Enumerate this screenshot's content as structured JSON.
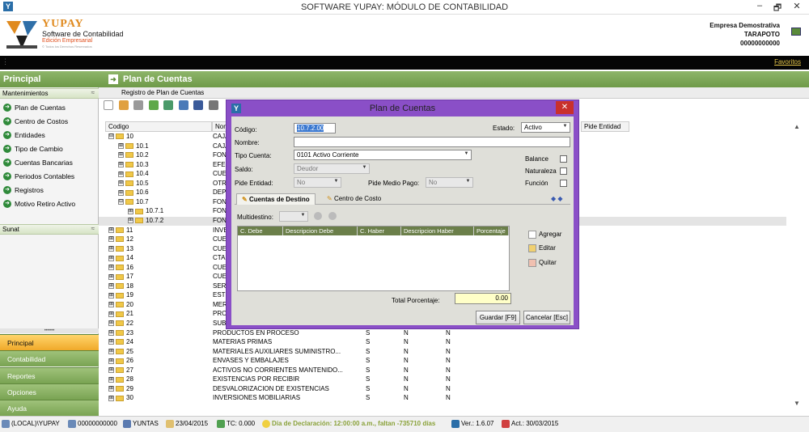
{
  "window": {
    "title": "SOFTWARE YUPAY: MÓDULO DE CONTABILIDAD",
    "minimize": "–",
    "restore": "🗗",
    "close": "✕"
  },
  "brand": {
    "name": "YUPAY",
    "subtitle": "Software de Contabilidad",
    "edition": "Edición Empresarial",
    "copyright": "© Todos los Derechos Reservados"
  },
  "company": {
    "name": "Empresa Demostrativa",
    "city": "TARAPOTO",
    "ruc": "00000000000"
  },
  "favorites_link": "Favoritos",
  "sidebar": {
    "title": "Principal",
    "section1": "Mantenimientos",
    "items": [
      {
        "label": "Plan de Cuentas"
      },
      {
        "label": "Centro de Costos"
      },
      {
        "label": "Entidades"
      },
      {
        "label": "Tipo de Cambio"
      },
      {
        "label": "Cuentas Bancarias"
      },
      {
        "label": "Periodos Contables"
      },
      {
        "label": "Registros"
      },
      {
        "label": "Motivo Retiro Activo"
      }
    ],
    "section2": "Sunat",
    "grip": "••••••",
    "modules": [
      "Principal",
      "Contabilidad",
      "Reportes",
      "Opciones",
      "Ayuda"
    ]
  },
  "main": {
    "title": "Plan de Cuentas",
    "tab": "Registro de Plan de Cuentas",
    "columns": {
      "codigo": "Codigo",
      "nombre": "Nombre",
      "pide_entidad": "Pide Entidad"
    },
    "tree": [
      {
        "code": "10",
        "level": 0,
        "sign": "⊟",
        "name": "CAJA Y BANCOS",
        "c1": "",
        "c2": "",
        "c3": ""
      },
      {
        "code": "10.1",
        "level": 1,
        "sign": "⊞",
        "name": "CAJA",
        "c1": "",
        "c2": "",
        "c3": ""
      },
      {
        "code": "10.2",
        "level": 1,
        "sign": "⊞",
        "name": "FONDOS FIJOS",
        "c1": "",
        "c2": "",
        "c3": ""
      },
      {
        "code": "10.3",
        "level": 1,
        "sign": "⊞",
        "name": "EFECTIVO EN TRANSITO",
        "c1": "",
        "c2": "",
        "c3": ""
      },
      {
        "code": "10.4",
        "level": 1,
        "sign": "⊞",
        "name": "CUENTAS CORRIENTES",
        "c1": "",
        "c2": "",
        "c3": ""
      },
      {
        "code": "10.5",
        "level": 1,
        "sign": "⊞",
        "name": "OTROS EQUIVALENTES",
        "c1": "",
        "c2": "",
        "c3": ""
      },
      {
        "code": "10.6",
        "level": 1,
        "sign": "⊞",
        "name": "DEPOSITOS A PLAZO",
        "c1": "",
        "c2": "",
        "c3": ""
      },
      {
        "code": "10.7",
        "level": 1,
        "sign": "⊟",
        "name": "FONDOS SUJETOS A RESTRICCION",
        "c1": "",
        "c2": "",
        "c3": ""
      },
      {
        "code": "10.7.1",
        "level": 2,
        "sign": "⊞",
        "name": "FONDOS",
        "c1": "",
        "c2": "",
        "c3": ""
      },
      {
        "code": "10.7.2",
        "level": 2,
        "sign": "⊞",
        "name": "FONDOS",
        "c1": "",
        "c2": "",
        "c3": "",
        "selected": true
      },
      {
        "code": "11",
        "level": 0,
        "sign": "⊞",
        "name": "INVERSIONES",
        "c1": "",
        "c2": "",
        "c3": ""
      },
      {
        "code": "12",
        "level": 0,
        "sign": "⊞",
        "name": "CUENTAS POR COBRAR",
        "c1": "",
        "c2": "",
        "c3": ""
      },
      {
        "code": "13",
        "level": 0,
        "sign": "⊞",
        "name": "CUENTAS",
        "c1": "",
        "c2": "",
        "c3": ""
      },
      {
        "code": "14",
        "level": 0,
        "sign": "⊞",
        "name": "CTAS",
        "c1": "",
        "c2": "",
        "c3": ""
      },
      {
        "code": "16",
        "level": 0,
        "sign": "⊞",
        "name": "CUENTAS",
        "c1": "",
        "c2": "",
        "c3": ""
      },
      {
        "code": "17",
        "level": 0,
        "sign": "⊞",
        "name": "CUENTAS",
        "c1": "",
        "c2": "",
        "c3": ""
      },
      {
        "code": "18",
        "level": 0,
        "sign": "⊞",
        "name": "SERVICIOS",
        "c1": "",
        "c2": "",
        "c3": ""
      },
      {
        "code": "19",
        "level": 0,
        "sign": "⊞",
        "name": "ESTIMACION",
        "c1": "",
        "c2": "",
        "c3": ""
      },
      {
        "code": "20",
        "level": 0,
        "sign": "⊞",
        "name": "MERCADERIAS",
        "c1": "",
        "c2": "",
        "c3": ""
      },
      {
        "code": "21",
        "level": 0,
        "sign": "⊞",
        "name": "PRODUCTOS",
        "c1": "",
        "c2": "",
        "c3": ""
      },
      {
        "code": "22",
        "level": 0,
        "sign": "⊞",
        "name": "SUBPRODUCTOS",
        "c1": "",
        "c2": "",
        "c3": ""
      },
      {
        "code": "23",
        "level": 0,
        "sign": "⊞",
        "name": "PRODUCTOS EN PROCESO",
        "c1": "S",
        "c2": "N",
        "c3": "N"
      },
      {
        "code": "24",
        "level": 0,
        "sign": "⊞",
        "name": "MATERIAS PRIMAS",
        "c1": "S",
        "c2": "N",
        "c3": "N"
      },
      {
        "code": "25",
        "level": 0,
        "sign": "⊞",
        "name": "MATERIALES AUXILIARES SUMINISTRO...",
        "c1": "S",
        "c2": "N",
        "c3": "N"
      },
      {
        "code": "26",
        "level": 0,
        "sign": "⊞",
        "name": "ENVASES Y EMBALAJES",
        "c1": "S",
        "c2": "N",
        "c3": "N"
      },
      {
        "code": "27",
        "level": 0,
        "sign": "⊞",
        "name": "ACTIVOS NO CORRIENTES MANTENIDO...",
        "c1": "S",
        "c2": "N",
        "c3": "N"
      },
      {
        "code": "28",
        "level": 0,
        "sign": "⊞",
        "name": "EXISTENCIAS POR RECIBIR",
        "c1": "S",
        "c2": "N",
        "c3": "N"
      },
      {
        "code": "29",
        "level": 0,
        "sign": "⊞",
        "name": "DESVALORIZACION DE EXISTENCIAS",
        "c1": "S",
        "c2": "N",
        "c3": "N"
      },
      {
        "code": "30",
        "level": 0,
        "sign": "⊞",
        "name": "INVERSIONES MOBILIARIAS",
        "c1": "S",
        "c2": "N",
        "c3": "N"
      }
    ]
  },
  "dialog": {
    "title": "Plan de Cuentas",
    "close": "✕",
    "codigo_label": "Código:",
    "codigo_value": "10.7.2.00",
    "estado_label": "Estado:",
    "estado_value": "Activo",
    "nombre_label": "Nombre:",
    "nombre_value": "",
    "tipo_label": "Tipo Cuenta:",
    "tipo_value": "0101   Activo Corriente",
    "saldo_label": "Saldo:",
    "saldo_value": "Deudor",
    "pide_entidad_label": "Pide Entidad:",
    "pide_entidad_value": "No",
    "pide_medio_label": "Pide Medio Pago:",
    "pide_medio_value": "No",
    "balance_label": "Balance",
    "naturaleza_label": "Naturaleza",
    "funcion_label": "Función",
    "tab1": "Cuentas de Destino",
    "tab2": "Centro de Costo",
    "multidestino_label": "Multidestino:",
    "grid_cols": [
      "C. Debe",
      "Descripcion Debe",
      "C. Haber",
      "Descripcion Haber",
      "Porcentaje"
    ],
    "agregar": "Agregar",
    "editar": "Editar",
    "quitar": "Quitar",
    "total_label": "Total Porcentaje:",
    "total_value": "0.00",
    "guardar": "Guardar [F9]",
    "cancelar": "Cancelar [Esc]"
  },
  "status": {
    "server": "(LOCAL)\\YUPAY",
    "ruc": "00000000000",
    "user": "YUNTAS",
    "date": "23/04/2015",
    "tc": "TC: 0.000",
    "declaracion": "Día de Declaración: 12:00:00 a.m., faltan -735710 días",
    "version": "Ver.: 1.6.07",
    "act": "Act.: 30/03/2015"
  }
}
